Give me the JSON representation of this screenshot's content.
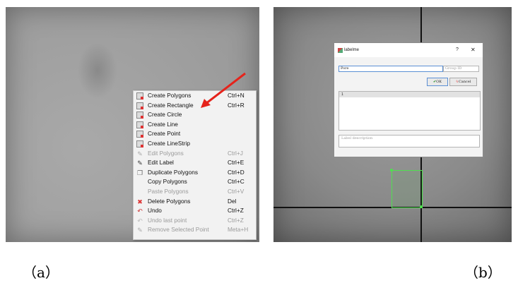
{
  "panel_a": {
    "menu_items": [
      {
        "label": "Create Polygons",
        "shortcut": "Ctrl+N",
        "enabled": true,
        "icon": "create-shape-icon"
      },
      {
        "label": "Create Rectangle",
        "shortcut": "Ctrl+R",
        "enabled": true,
        "icon": "create-shape-icon"
      },
      {
        "label": "Create Circle",
        "shortcut": "",
        "enabled": true,
        "icon": "create-shape-icon"
      },
      {
        "label": "Create Line",
        "shortcut": "",
        "enabled": true,
        "icon": "create-shape-icon"
      },
      {
        "label": "Create Point",
        "shortcut": "",
        "enabled": true,
        "icon": "create-shape-icon"
      },
      {
        "label": "Create LineStrip",
        "shortcut": "",
        "enabled": true,
        "icon": "create-shape-icon"
      },
      {
        "label": "Edit Polygons",
        "shortcut": "Ctrl+J",
        "enabled": false,
        "icon": "edit-icon"
      },
      {
        "label": "Edit Label",
        "shortcut": "Ctrl+E",
        "enabled": true,
        "icon": "edit-icon"
      },
      {
        "label": "Duplicate Polygons",
        "shortcut": "Ctrl+D",
        "enabled": true,
        "icon": "duplicate-icon"
      },
      {
        "label": "Copy Polygons",
        "shortcut": "Ctrl+C",
        "enabled": true,
        "icon": ""
      },
      {
        "label": "Paste Polygons",
        "shortcut": "Ctrl+V",
        "enabled": false,
        "icon": ""
      },
      {
        "label": "Delete Polygons",
        "shortcut": "Del",
        "enabled": true,
        "icon": "delete-icon"
      },
      {
        "label": "Undo",
        "shortcut": "Ctrl+Z",
        "enabled": true,
        "icon": "undo-icon"
      },
      {
        "label": "Undo last point",
        "shortcut": "Ctrl+Z",
        "enabled": false,
        "icon": "undo-icon"
      },
      {
        "label": "Remove Selected Point",
        "shortcut": "Meta+H",
        "enabled": false,
        "icon": "edit-icon"
      }
    ],
    "arrow_color": "#e5231b"
  },
  "panel_b": {
    "dialog": {
      "title": "labelme",
      "help": "?",
      "close": "✕",
      "label_value": "Pore",
      "group_placeholder": "Group ID",
      "ok_label": "OK",
      "cancel_label": "Cancel",
      "list_header": "1",
      "description_placeholder": "Label description"
    },
    "box_color": "#4fe04f"
  },
  "captions": {
    "a": "（a）",
    "b": "（b）"
  }
}
